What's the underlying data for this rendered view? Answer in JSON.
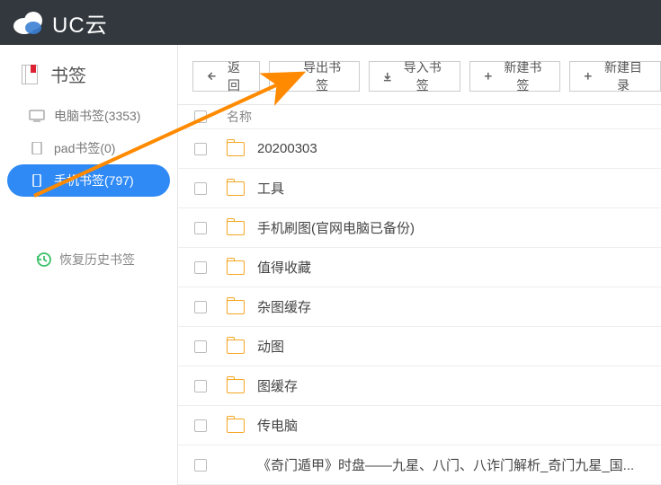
{
  "header": {
    "app_name": "UC云"
  },
  "sidebar": {
    "title": "书签",
    "items": [
      {
        "label": "电脑书签(3353)"
      },
      {
        "label": "pad书签(0)"
      },
      {
        "label": "手机书签(797)"
      }
    ],
    "restore_label": "恢复历史书签"
  },
  "toolbar": {
    "back": "返回",
    "export": "导出书签",
    "import": "导入书签",
    "new_bookmark": "新建书签",
    "new_folder": "新建目录"
  },
  "list": {
    "header_name": "名称",
    "rows": [
      {
        "name": "20200303",
        "is_folder": true
      },
      {
        "name": "工具",
        "is_folder": true
      },
      {
        "name": "手机刷图(官网电脑已备份)",
        "is_folder": true
      },
      {
        "name": "值得收藏",
        "is_folder": true
      },
      {
        "name": "杂图缓存",
        "is_folder": true
      },
      {
        "name": "动图",
        "is_folder": true
      },
      {
        "name": "图缓存",
        "is_folder": true
      },
      {
        "name": "传电脑",
        "is_folder": true
      },
      {
        "name": "《奇门遁甲》时盘——九星、八门、八诈门解析_奇门九星_国...",
        "is_folder": false
      }
    ]
  },
  "colors": {
    "accent": "#2f8af5",
    "folder": "#f5a623",
    "arrow": "#ff8a00",
    "header_bg": "#32383d"
  }
}
